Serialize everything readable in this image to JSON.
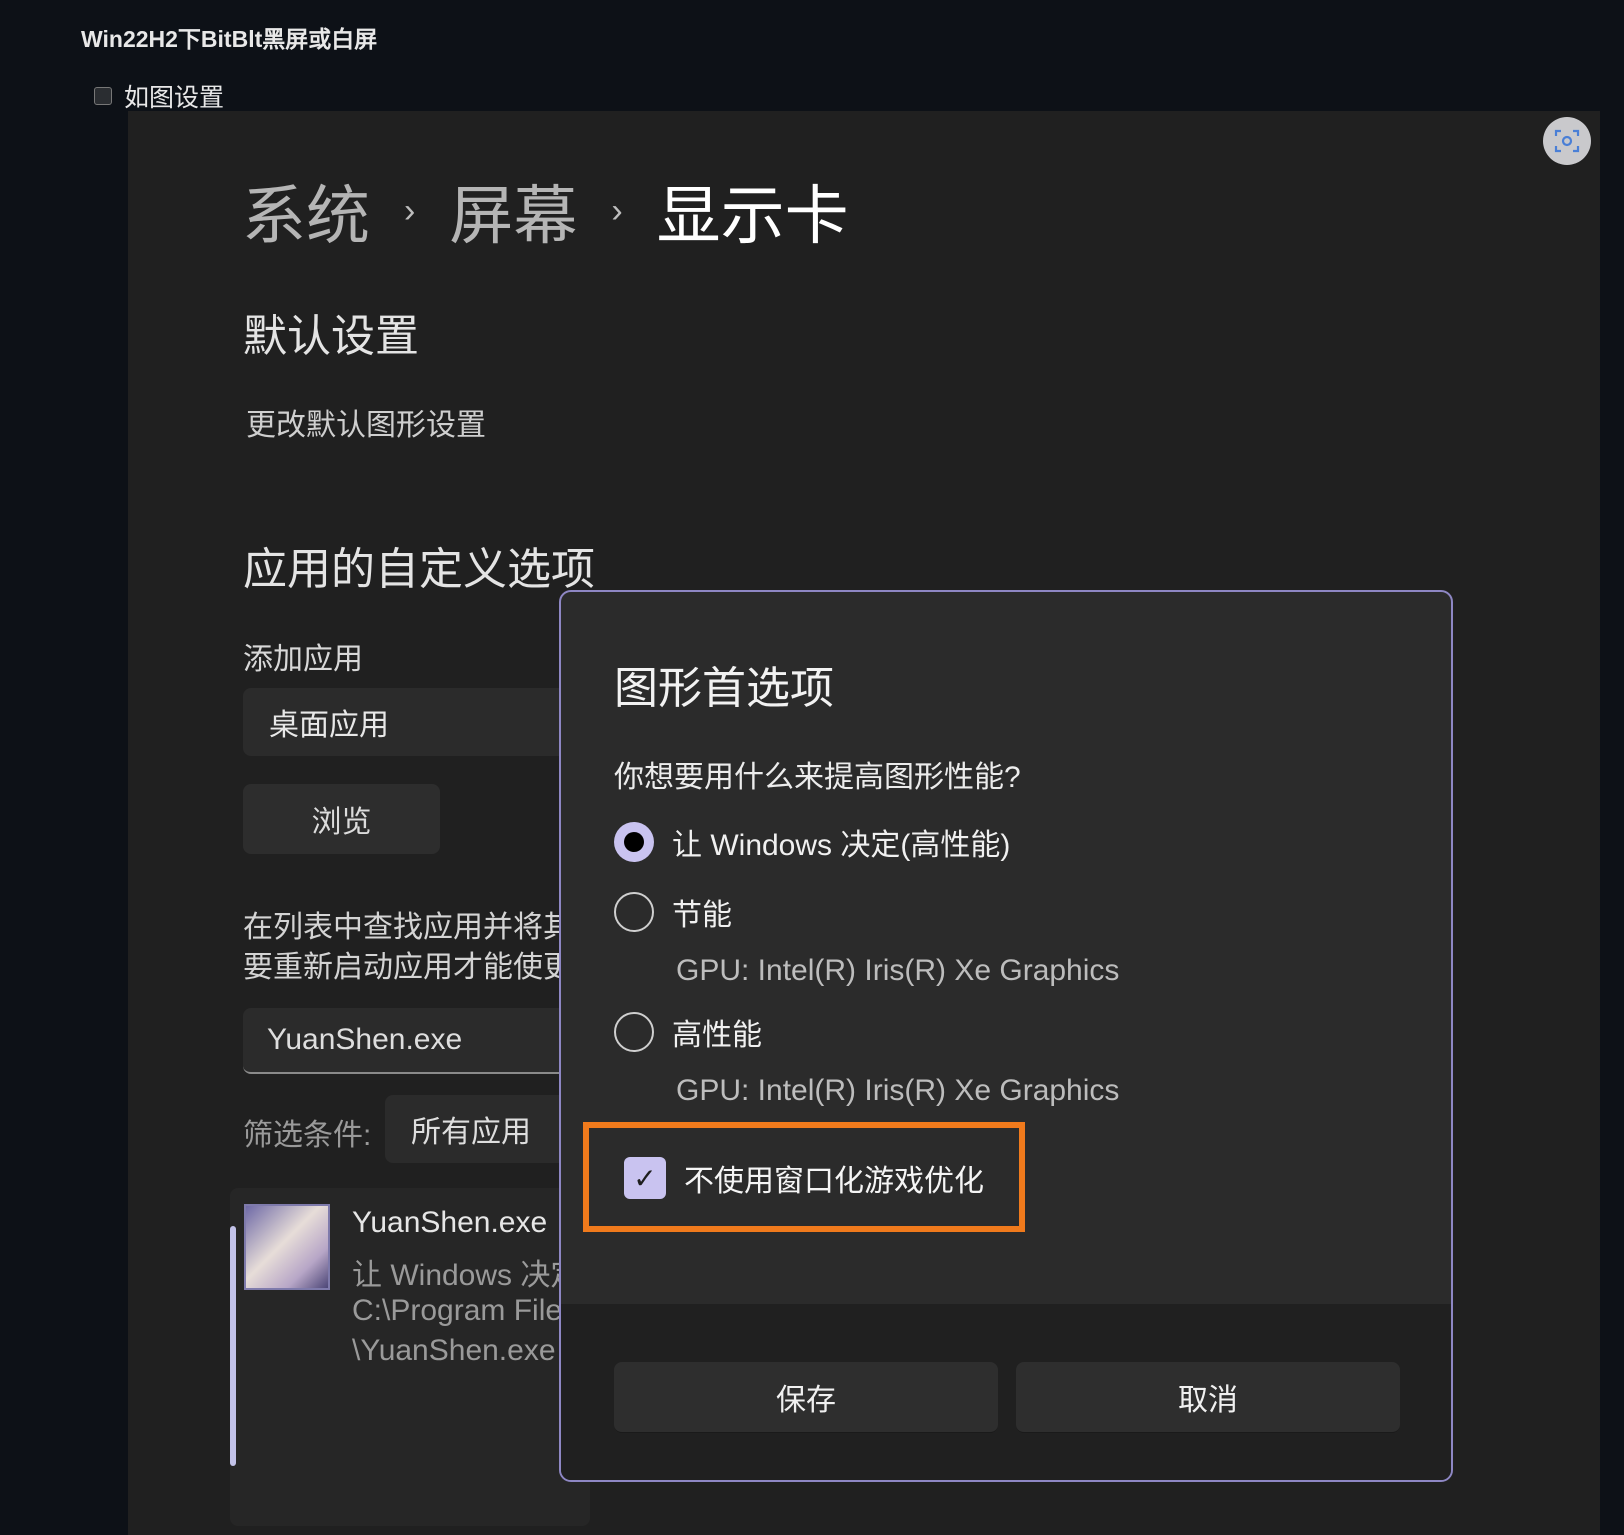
{
  "page": {
    "title": "Win22H2下BitBlt黑屏或白屏",
    "task_label": "如图设置",
    "task_checked": false
  },
  "screenshot": {
    "breadcrumb": [
      "系统",
      "屏幕",
      "显示卡"
    ],
    "breadcrumb_sep": "›",
    "default_heading": "默认设置",
    "default_link": "更改默认图形设置",
    "custom_heading": "应用的自定义选项",
    "add_app_label": "添加应用",
    "app_type_value": "桌面应用",
    "browse_label": "浏览",
    "find_text_line1": "在列表中查找应用并将其",
    "find_text_line2": "要重新启动应用才能使更",
    "search_value": "YuanShen.exe",
    "filter_label": "筛选条件:",
    "filter_value": "所有应用",
    "app_item": {
      "name": "YuanShen.exe",
      "pref": "让 Windows 决定",
      "path1": "C:\\Program Files",
      "path2": "\\YuanShen.exe"
    }
  },
  "dialog": {
    "title": "图形首选项",
    "question": "你想要用什么来提高图形性能?",
    "options": [
      {
        "label": "让 Windows 决定(高性能)",
        "selected": true,
        "gpu": ""
      },
      {
        "label": "节能",
        "selected": false,
        "gpu": "GPU: Intel(R) Iris(R) Xe Graphics"
      },
      {
        "label": "高性能",
        "selected": false,
        "gpu": "GPU: Intel(R) Iris(R) Xe Graphics"
      }
    ],
    "checkbox_label": "不使用窗口化游戏优化",
    "checkbox_checked": true,
    "checkmark": "✓",
    "save_label": "保存",
    "cancel_label": "取消"
  },
  "colors": {
    "accent": "#c9c3f0",
    "highlight": "#f07a1c",
    "dialog_border": "#8e87c4"
  }
}
